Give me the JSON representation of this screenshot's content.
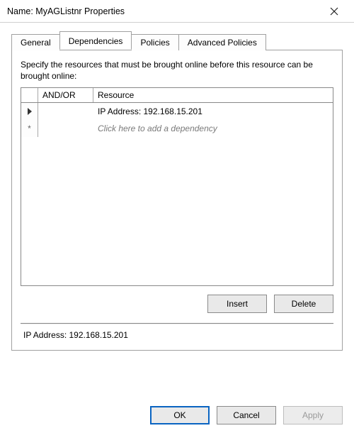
{
  "window": {
    "title": "Name: MyAGListnr Properties"
  },
  "tabs": [
    {
      "label": "General"
    },
    {
      "label": "Dependencies",
      "active": true
    },
    {
      "label": "Policies"
    },
    {
      "label": "Advanced Policies"
    }
  ],
  "dependencies": {
    "instruction": "Specify the resources that must be brought online before this resource can be brought online:",
    "columns": {
      "andor": "AND/OR",
      "resource": "Resource"
    },
    "rows": [
      {
        "marker": "current",
        "andor": "",
        "resource": "IP Address: 192.168.15.201"
      },
      {
        "marker": "new",
        "andor": "",
        "resource_placeholder": "Click here to add a dependency"
      }
    ],
    "buttons": {
      "insert": "Insert",
      "delete": "Delete"
    },
    "status": "IP Address: 192.168.15.201"
  },
  "dialogButtons": {
    "ok": "OK",
    "cancel": "Cancel",
    "apply": "Apply"
  }
}
